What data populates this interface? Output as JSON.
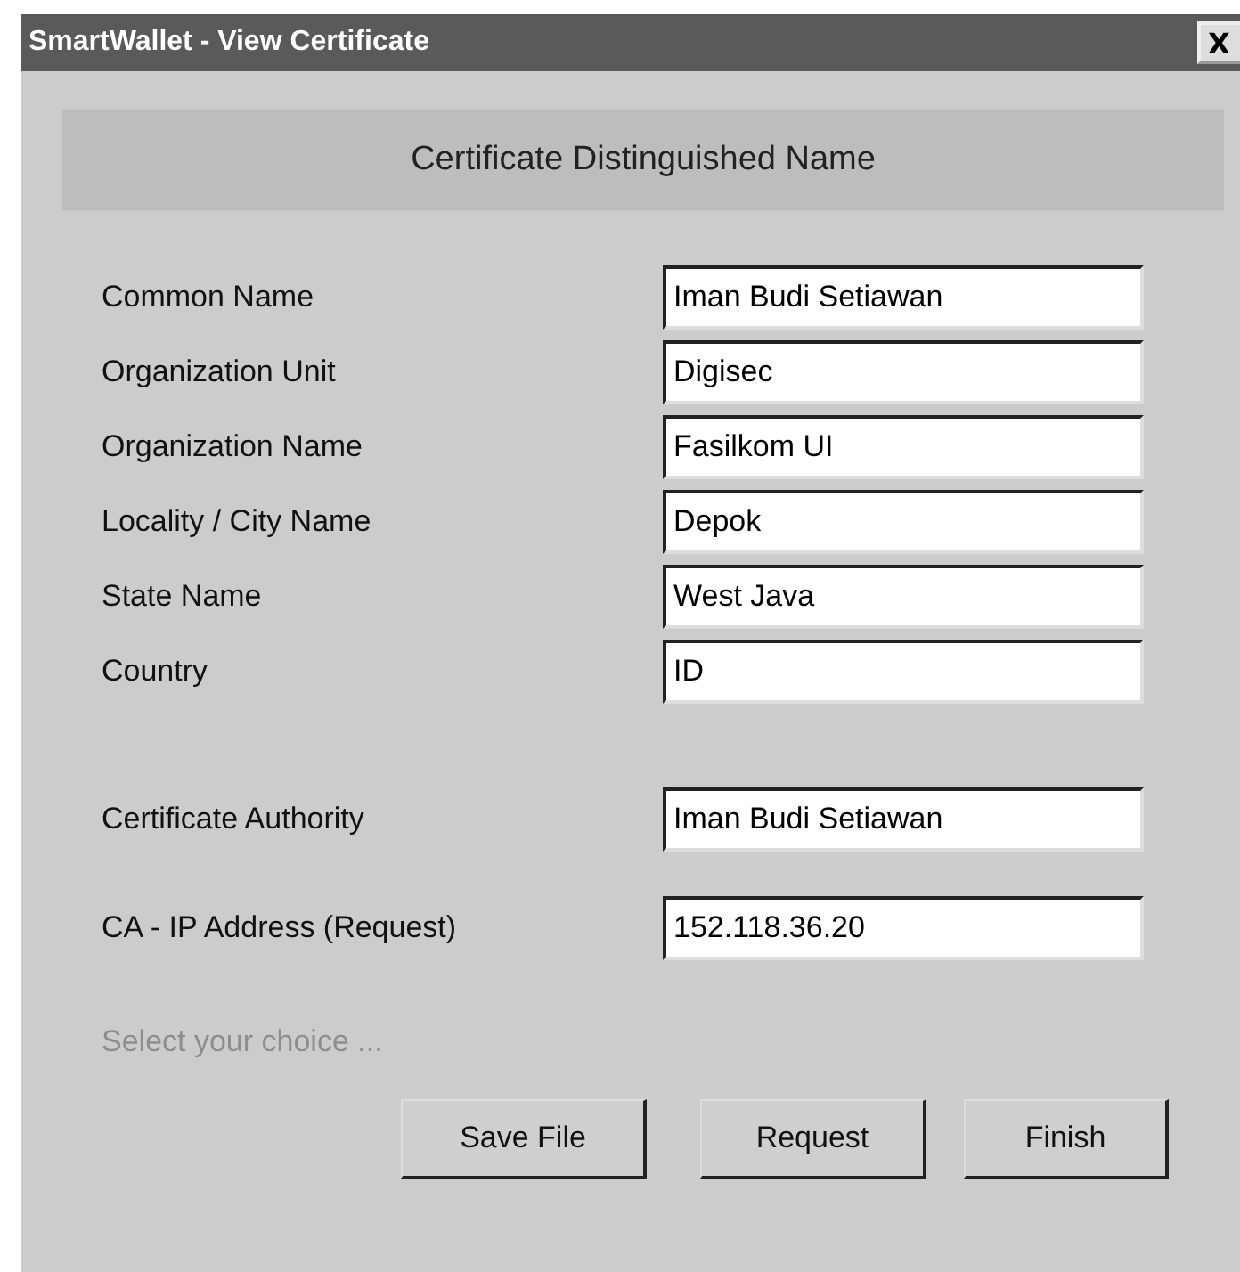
{
  "window": {
    "title": "SmartWallet - View Certificate",
    "close": "X"
  },
  "header": "Certificate Distinguished Name",
  "name_fields": [
    {
      "label": "Common Name",
      "value": "Iman Budi Setiawan"
    },
    {
      "label": "Organization Unit",
      "value": "Digisec"
    },
    {
      "label": "Organization Name",
      "value": "Fasilkom UI"
    },
    {
      "label": "Locality / City Name",
      "value": "Depok"
    },
    {
      "label": "State Name",
      "value": "West Java"
    },
    {
      "label": "Country",
      "value": "ID"
    }
  ],
  "authority_fields": [
    {
      "label": "Certificate Authority",
      "value": "Iman Budi Setiawan"
    },
    {
      "label": "CA - IP Address (Request)",
      "value": "152.118.36.20"
    }
  ],
  "hint": "Select your choice ...",
  "buttons": [
    "Save File",
    "Request",
    "Finish"
  ]
}
